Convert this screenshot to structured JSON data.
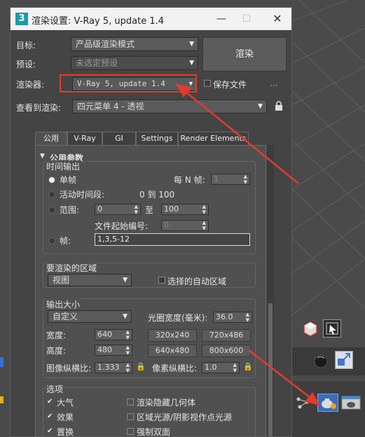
{
  "window": {
    "title": "渲染设置: V-Ray 5, update 1.4",
    "app_icon": "3"
  },
  "top": {
    "target_label": "目标:",
    "target_value": "产品级渲染模式",
    "preset_label": "预设:",
    "preset_value": "未选定预设",
    "renderer_label": "渲染器:",
    "renderer_value": "V-Ray 5, update 1.4",
    "save_file_label": "保存文件",
    "dots_label": "...",
    "render_button": "渲染",
    "view_label": "查看到渲染:",
    "view_value": "四元菜单 4 - 透视"
  },
  "tabs": [
    "公用",
    "V-Ray",
    "GI",
    "Settings",
    "Render Elements"
  ],
  "common": {
    "rollout_title": "公用参数",
    "time_output": {
      "heading": "时间输出",
      "single": "单帧",
      "every_n_label": "每 N 帧:",
      "every_n_value": "1",
      "active_segment": "活动时间段:",
      "active_range": "0 到 100",
      "range": "范围:",
      "range_from": "0",
      "range_to_label": "至",
      "range_to": "100",
      "file_start_label": "文件起始编号:",
      "file_start_value": "0",
      "frames": "帧:",
      "frames_value": "1,3,5-12"
    },
    "area": {
      "heading": "要渲染的区域",
      "value": "视图",
      "auto_region": "选择的自动区域"
    },
    "output_size": {
      "heading": "输出大小",
      "preset_value": "自定义",
      "aperture_label": "光圈宽度(毫米):",
      "aperture_value": "36.0",
      "width_label": "宽度:",
      "width_value": "640",
      "height_label": "高度:",
      "height_value": "480",
      "presets": [
        "320x240",
        "720x486",
        "640x480",
        "800x600"
      ],
      "image_aspect_label": "图像纵横比:",
      "image_aspect_value": "1.333",
      "pixel_aspect_label": "像素纵横比:",
      "pixel_aspect_value": "1.0"
    },
    "options": {
      "heading": "选项",
      "items": [
        {
          "label": "大气",
          "checked": true
        },
        {
          "label": "渲染隐藏几何体",
          "checked": false
        },
        {
          "label": "效果",
          "checked": true
        },
        {
          "label": "区域光源/阴影视作点光源",
          "checked": false
        },
        {
          "label": "置换",
          "checked": true
        },
        {
          "label": "强制双面",
          "checked": false
        }
      ]
    }
  },
  "colors": {
    "annotation_red": "#e23b2e",
    "accent_teal": "#1b9aa7"
  }
}
